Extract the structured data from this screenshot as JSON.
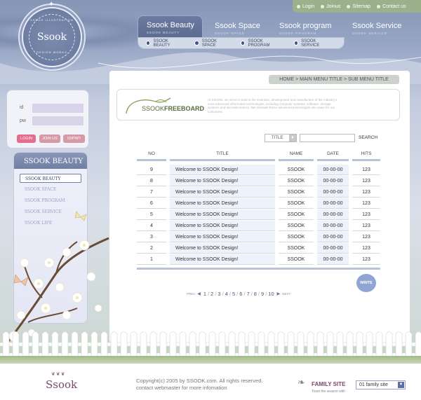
{
  "brand": {
    "name": "Ssook",
    "badge_top": "SSOOK ILLUSTRATION",
    "badge_bottom": "DESIGN WORKS"
  },
  "util_nav": [
    {
      "label": "Login"
    },
    {
      "label": "Joinus"
    },
    {
      "label": "Sitemap"
    },
    {
      "label": "Contact us"
    }
  ],
  "main_nav": [
    {
      "label": "Ssook Beauty",
      "sub": "SSOOK BEAUTY"
    },
    {
      "label": "Ssook Space",
      "sub": "SSOOK SPACE"
    },
    {
      "label": "Ssook program",
      "sub": "SSOOK PROGRAM"
    },
    {
      "label": "Ssook Service",
      "sub": "SSOOK SERVICE"
    }
  ],
  "sub_nav": [
    {
      "label": "SSOOK BEAUTY"
    },
    {
      "label": "SSOOK SPACE"
    },
    {
      "label": "SSOOK PROGRAM"
    },
    {
      "label": "SSOOK SERVICE"
    }
  ],
  "login": {
    "id_label": "id",
    "pw_label": "pw",
    "login_btn": "LOGIN",
    "join_btn": "JOIN US",
    "idpw_btn": "ID/PW?"
  },
  "side_menu": {
    "title": "SSOOK BEAUTY",
    "items": [
      {
        "label": "SSOOK BEAUTY",
        "active": true
      },
      {
        "label": "SSOOK SPACE"
      },
      {
        "label": "SSOOK PROGRAM"
      },
      {
        "label": "SSOOK SERVICE"
      },
      {
        "label": "SSOOK LIFE"
      }
    ]
  },
  "breadcrumb": "HOME > MAIN MENU TITLE > SUB MENU TITLE",
  "banner": {
    "title_light": "SSOOK",
    "title_bold": "FREEBOARD",
    "desc": "At SSOOK, we strive to lead in the invention, development and manufacture of the industry's most advanced information technologies, including computer systems, software, storage systems and microelectronics. We translate these advanced technologies into value for our customers."
  },
  "search": {
    "field": "TITLE",
    "button": "SEARCH"
  },
  "table": {
    "headers": {
      "no": "NO",
      "title": "TITLE",
      "name": "NAME",
      "date": "DATE",
      "hits": "HITS"
    },
    "rows": [
      {
        "no": "9",
        "title": "Welcome to SSOOK Design!",
        "name": "SSOOK",
        "date": "00-00-00",
        "hits": "123"
      },
      {
        "no": "8",
        "title": "Welcome to SSOOK Design!",
        "name": "SSOOK",
        "date": "00-00-00",
        "hits": "123"
      },
      {
        "no": "7",
        "title": "Welcome to SSOOK Design!",
        "name": "SSOOK",
        "date": "00-00-00",
        "hits": "123"
      },
      {
        "no": "6",
        "title": "Welcome to SSOOK Design!",
        "name": "SSOOK",
        "date": "00-00-00",
        "hits": "123"
      },
      {
        "no": "5",
        "title": "Welcome to SSOOK Design!",
        "name": "SSOOK",
        "date": "00-00-00",
        "hits": "123"
      },
      {
        "no": "4",
        "title": "Welcome to SSOOK Design!",
        "name": "SSOOK",
        "date": "00-00-00",
        "hits": "123"
      },
      {
        "no": "3",
        "title": "Welcome to SSOOK Design!",
        "name": "SSOOK",
        "date": "00-00-00",
        "hits": "123"
      },
      {
        "no": "2",
        "title": "Welcome to SSOOK Design!",
        "name": "SSOOK",
        "date": "00-00-00",
        "hits": "123"
      },
      {
        "no": "1",
        "title": "Welcome to SSOOK Design!",
        "name": "SSOOK",
        "date": "00-00-00",
        "hits": "123"
      }
    ]
  },
  "write_btn": "WRITE",
  "pagination": {
    "prev": "PREV",
    "next": "NEXT",
    "pages": [
      "1",
      "2",
      "3",
      "4",
      "5",
      "6",
      "7",
      "8",
      "9",
      "10"
    ]
  },
  "footer": {
    "logo": "Ssook",
    "copyright": "Copyright(c) 2005 by SSOOK.com.  All rights reserved.",
    "contact": "contact webmaster for more infomation",
    "family_label": "FAMILY SITE",
    "family_sub": "Toast the season with",
    "family_select": "01 family site"
  },
  "colors": {
    "header_blue": "#7e8db0",
    "accent_green": "#9bb08b",
    "table_rule": "#b8c3da",
    "login_pink": "#e56c8c"
  }
}
